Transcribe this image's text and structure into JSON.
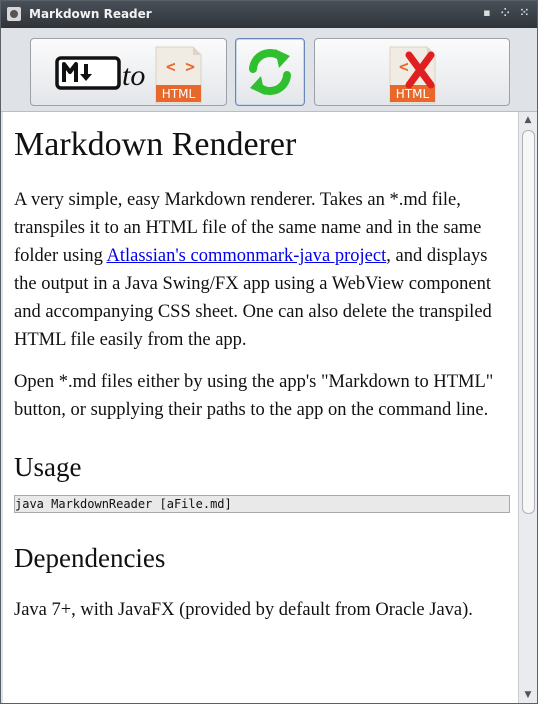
{
  "window": {
    "title": "Markdown Reader"
  },
  "toolbar": {
    "md_to_html": {
      "to_text": "to",
      "html_badge": "HTML"
    },
    "delete_html": {
      "html_badge": "HTML"
    }
  },
  "content": {
    "heading": "Markdown Renderer",
    "intro_before_link": "A very simple, easy Markdown renderer. Takes an *.md file, transpiles it to an HTML file of the same name and in the same folder using ",
    "intro_link": "Atlassian's commonmark-java project",
    "intro_after_link": ", and displays the output in a Java Swing/FX app using a WebView component and accompanying CSS sheet. One can also delete the transpiled HTML file easily from the app.",
    "open_paragraph": "Open *.md files either by using the app's \"Markdown to HTML\" button, or supplying their paths to the app on the command line.",
    "usage_heading": "Usage",
    "usage_code": "java MarkdownReader [aFile.md]",
    "deps_heading": "Dependencies",
    "deps_paragraph": "Java 7+, with JavaFX (provided by default from Oracle Java)."
  },
  "colors": {
    "accent_orange": "#e8672b",
    "refresh_green": "#2fbf2f",
    "delete_red": "#e02020",
    "link": "#0000ee"
  },
  "icons": {
    "markdown": "markdown-logo-icon",
    "html_file": "html-file-icon",
    "refresh": "refresh-icon",
    "delete": "delete-x-icon"
  }
}
